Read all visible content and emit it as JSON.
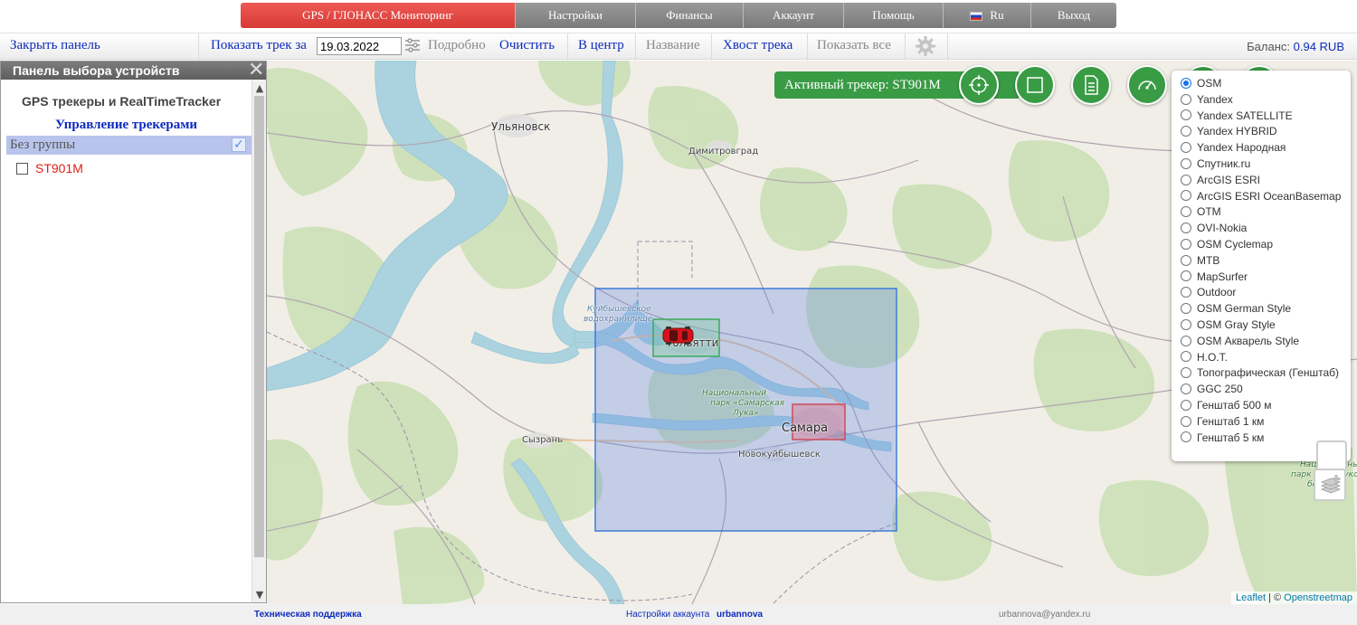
{
  "nav": {
    "tabs": [
      {
        "label": "GPS / ГЛОНАСС Мониторинг",
        "active": true
      },
      {
        "label": "Настройки"
      },
      {
        "label": "Финансы"
      },
      {
        "label": "Аккаунт"
      },
      {
        "label": "Помощь"
      },
      {
        "label": "Ru"
      },
      {
        "label": "Выход"
      }
    ]
  },
  "toolbar": {
    "close_panel": "Закрыть панель",
    "show_track": "Показать трек за",
    "date": "19.03.2022",
    "detailed": "Подробно",
    "clear": "Очистить",
    "center": "В центр",
    "name": "Название",
    "track_tail": "Хвост трека",
    "show_all": "Показать все",
    "balance_label": "Баланс:",
    "balance_value": "0.94 RUB"
  },
  "panel": {
    "title": "Панель выбора устройств",
    "section": "GPS трекеры и RealTimeTracker",
    "manage": "Управление трекерами",
    "group": "Без группы",
    "devices": [
      {
        "name": "ST901M",
        "checked": false
      }
    ]
  },
  "map": {
    "active_tracker": "Активный трекер: ST901M",
    "buttons": [
      "crosshair-icon",
      "square-icon",
      "document-icon",
      "speedometer-icon"
    ],
    "labels": {
      "ulyanovsk": "Ульяновск",
      "dimitrovgrad": "Димитровград",
      "reservoir_1": "Куйбышевское",
      "reservoir_2": "водохранилище",
      "tolyatti": "Тольятти",
      "park_1": "Национальный",
      "park_2": "парк «Самарская",
      "park_3": "Лука»",
      "samara": "Самара",
      "syzran": "Сызрань",
      "novokuybyshevsk": "Новокуйбышевск",
      "buzuluk_1": "Национальный",
      "buzuluk_2": "парк «Бузулукский",
      "buzuluk_3": "бор»"
    },
    "layers": [
      {
        "label": "OSM",
        "selected": true
      },
      {
        "label": "Yandex"
      },
      {
        "label": "Yandex SATELLITE"
      },
      {
        "label": "Yandex HYBRID"
      },
      {
        "label": "Yandex Народная"
      },
      {
        "label": "Спутник.ru"
      },
      {
        "label": "ArcGIS ESRI"
      },
      {
        "label": "ArcGIS ESRI OceanBasemap"
      },
      {
        "label": "OTM"
      },
      {
        "label": "OVI-Nokia"
      },
      {
        "label": "OSM Cyclemap"
      },
      {
        "label": "MTB"
      },
      {
        "label": "MapSurfer"
      },
      {
        "label": "Outdoor"
      },
      {
        "label": "OSM German Style"
      },
      {
        "label": "OSM Gray Style"
      },
      {
        "label": "OSM Акварель Style"
      },
      {
        "label": "H.O.T."
      },
      {
        "label": "Топографическая (Генштаб)"
      },
      {
        "label": "GGC 250"
      },
      {
        "label": "Генштаб 500 м"
      },
      {
        "label": "Генштаб 1 км"
      },
      {
        "label": "Генштаб 5 км"
      }
    ],
    "attribution": {
      "leaflet": "Leaflet",
      "sep": " | © ",
      "osm": "Openstreetmap"
    }
  },
  "footer": {
    "support": "Техническая поддержка",
    "account_settings": "Настройки аккаунта",
    "username": "urbannova",
    "email": "urbannova@yandex.ru"
  },
  "colors": {
    "active_tab": "#d63a35",
    "link": "#0d2bbd",
    "tracker_green": "#3a9b45",
    "device_red": "#e0201a"
  }
}
